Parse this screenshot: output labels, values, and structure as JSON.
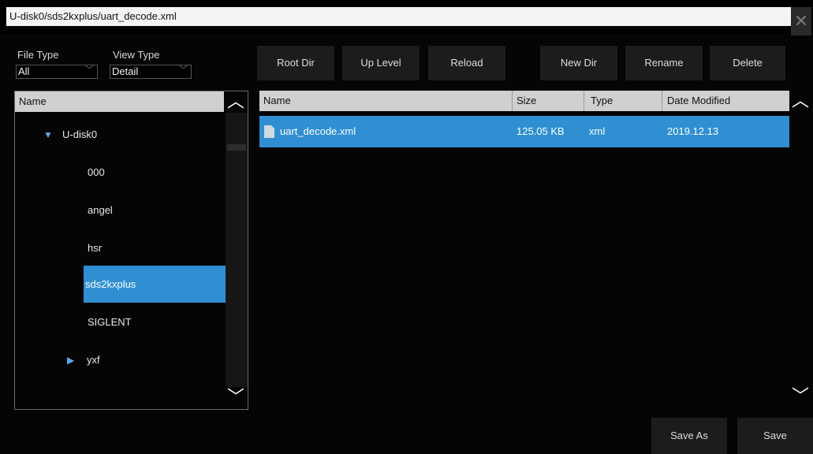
{
  "window": {
    "path": "U-disk0/sds2kxplus/uart_decode.xml",
    "close_icon": "close-icon"
  },
  "controls": {
    "file_type_label": "File Type",
    "file_type_value": "All",
    "view_type_label": "View Type",
    "view_type_value": "Detail"
  },
  "toolbar": {
    "root_dir": "Root Dir",
    "up_level": "Up Level",
    "reload": "Reload",
    "new_dir": "New Dir",
    "rename": "Rename",
    "delete": "Delete"
  },
  "tree": {
    "header": "Name",
    "root": "U-disk0",
    "items": [
      "000",
      "angel",
      "hsr",
      "sds2kxplus",
      "SIGLENT",
      "yxf"
    ],
    "selected": "sds2kxplus"
  },
  "filelist": {
    "columns": [
      "Name",
      "Size",
      "Type",
      "Date Modified"
    ],
    "rows": [
      {
        "name": "uart_decode.xml",
        "size": "125.05 KB",
        "type": "xml",
        "date": "2019.12.13"
      }
    ]
  },
  "footer": {
    "save_as": "Save As",
    "save": "Save"
  },
  "colors": {
    "selection": "#2f8fd2",
    "header_bg": "#d0d0d0",
    "button_bg": "#1c1c1c"
  }
}
